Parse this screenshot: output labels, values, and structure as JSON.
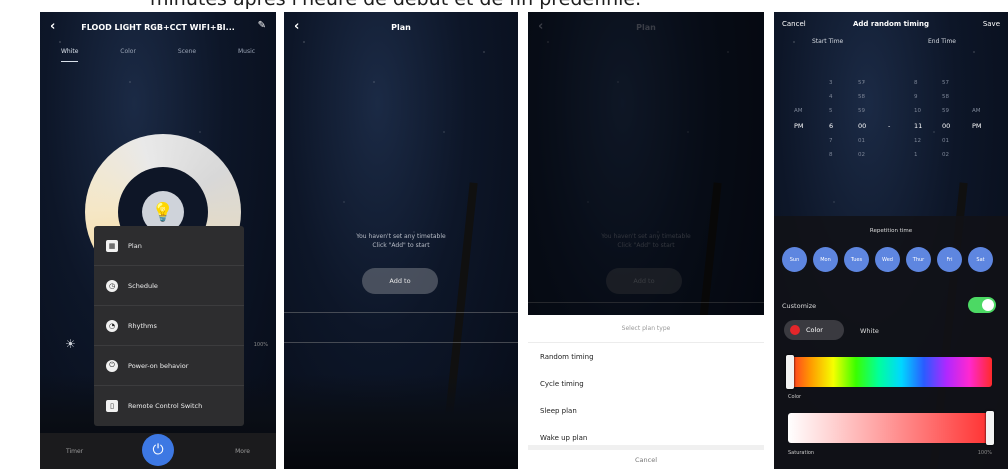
{
  "caption": "minutes après l'heure de début et de fin prédéfinie.",
  "screen1": {
    "title": "FLOOD LIGHT RGB+CCT WIFI+BI...",
    "tabs": [
      "White",
      "Color",
      "Scene",
      "Music"
    ],
    "brightness_pct": "100%",
    "menu": [
      "Plan",
      "Schedule",
      "Rhythms",
      "Power-on behavior",
      "Remote Control Switch"
    ],
    "bottom": {
      "left": "Timer",
      "right": "More"
    }
  },
  "screen2": {
    "title": "Plan",
    "empty_line1": "You haven't set any timetable",
    "empty_line2": "Click \"Add\" to start",
    "add_button": "Add to"
  },
  "screen3": {
    "title": "Plan",
    "empty_line1": "You haven't set any timetable",
    "empty_line2": "Click \"Add\" to start",
    "add_button": "Add to",
    "sheet_title": "Select plan type",
    "options": [
      "Random timing",
      "Cycle timing",
      "Sleep plan",
      "Wake up plan"
    ],
    "cancel": "Cancel"
  },
  "screen4": {
    "cancel": "Cancel",
    "title": "Add random timing",
    "save": "Save",
    "start_label": "Start Time",
    "end_label": "End Time",
    "picker": {
      "am": "AM",
      "pm": "PM",
      "dash": "-",
      "start_hours": [
        "3",
        "4",
        "5",
        "6",
        "7",
        "8"
      ],
      "start_minutes": [
        "57",
        "58",
        "59",
        "00",
        "01",
        "02"
      ],
      "end_hours": [
        "8",
        "9",
        "10",
        "11",
        "12",
        "1"
      ],
      "end_minutes": [
        "57",
        "58",
        "59",
        "00",
        "01",
        "02"
      ]
    },
    "repetition_title": "Repetition time",
    "days": [
      "Sun",
      "Mon",
      "Tues",
      "Wed",
      "Thur",
      "Fri",
      "Sat"
    ],
    "customize": "Customize",
    "color_btn": "Color",
    "white_btn": "White",
    "color_label": "Color",
    "saturation_label": "Saturation",
    "saturation_pct": "100%"
  }
}
